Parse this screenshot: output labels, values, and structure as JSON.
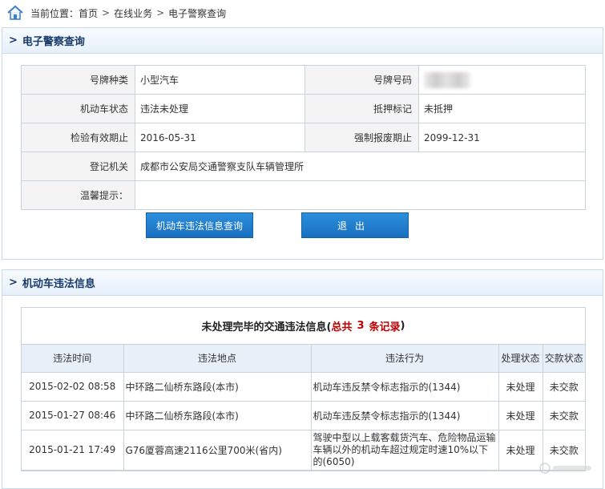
{
  "breadcrumb": {
    "prefix": "当前位置：",
    "items": [
      "首页",
      "在线业务",
      "电子警察查询"
    ],
    "separator": ">"
  },
  "panel1": {
    "title": "电子警察查询",
    "fields": [
      {
        "label": "号牌种类",
        "value": "小型汽车"
      },
      {
        "label": "号牌号码",
        "value": ""
      },
      {
        "label": "机动车状态",
        "value": "违法未处理"
      },
      {
        "label": "抵押标记",
        "value": "未抵押"
      },
      {
        "label": "检验有效期止",
        "value": "2016-05-31"
      },
      {
        "label": "强制报废期止",
        "value": "2099-12-31"
      },
      {
        "label": "登记机关",
        "value": "成都市公安局交通警察支队车辆管理所"
      },
      {
        "label": "温馨提示：",
        "value": ""
      }
    ],
    "buttons": {
      "query": "机动车违法信息查询",
      "exit": "退出"
    }
  },
  "panel2": {
    "title": "机动车违法信息",
    "summary": {
      "prefix": "未处理完毕的交通违法信息(",
      "total_pre": "总共",
      "count": "3",
      "total_post": "条记录",
      "suffix": ")"
    },
    "columns": [
      "违法时间",
      "违法地点",
      "违法行为",
      "处理状态",
      "交款状态"
    ],
    "rows": [
      [
        "2015-02-02 08:58",
        "中环路二仙桥东路段(本市)",
        "机动车违反禁令标志指示的(1344)",
        "未处理",
        "未交款"
      ],
      [
        "2015-01-27 08:46",
        "中环路二仙桥东路段(本市)",
        "机动车违反禁令标志指示的(1344)",
        "未处理",
        "未交款"
      ],
      [
        "2015-01-21 17:49",
        "G76厦蓉高速2116公里700米(省内)",
        "驾驶中型以上载客载货汽车、危险物品运输车辆以外的机动车超过规定时速10%以下的(6050)",
        "未处理",
        "未交款"
      ]
    ]
  },
  "watermark": "汽车之家"
}
